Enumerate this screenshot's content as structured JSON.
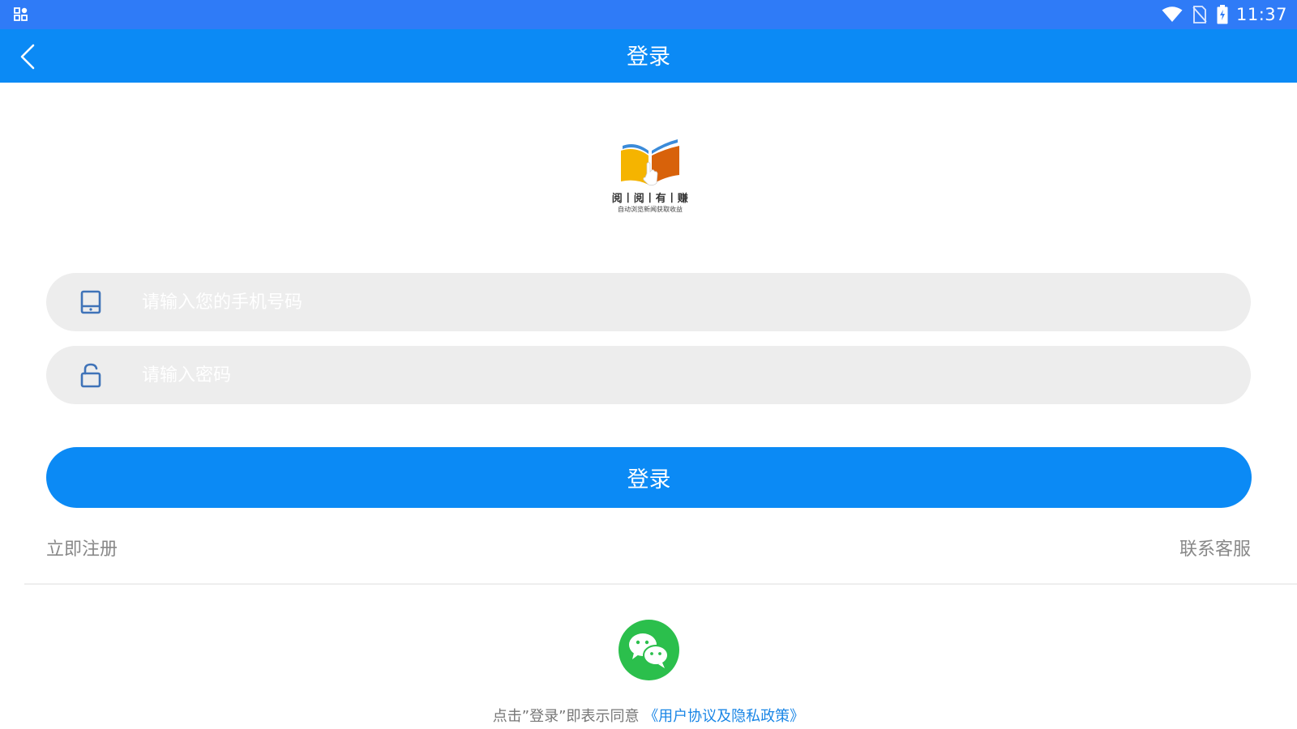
{
  "status_bar": {
    "time": "11:37",
    "icons": [
      "app-grid-icon",
      "wifi-icon",
      "no-sim-icon",
      "battery-charging-icon"
    ]
  },
  "header": {
    "title": "登录",
    "back_icon": "chevron-left-icon"
  },
  "logo": {
    "name": "阅丨阅丨有丨赚",
    "slogan": "自动浏览新闻获取收益"
  },
  "form": {
    "phone": {
      "value": "",
      "placeholder": "请输入您的手机号码",
      "icon": "phone-icon"
    },
    "password": {
      "value": "",
      "placeholder": "请输入密码",
      "icon": "lock-open-icon"
    },
    "login_label": "登录"
  },
  "links": {
    "register": "立即注册",
    "support": "联系客服"
  },
  "social": {
    "wechat_icon": "wechat-icon"
  },
  "agreement": {
    "prefix": "点击”登录”即表示同意",
    "link": "《用户协议及隐私政策》"
  },
  "colors": {
    "status_bar": "#2f7bf7",
    "primary": "#0b8af5",
    "input_bg": "#ededed",
    "wechat": "#2bbf4c",
    "link": "#1a86e6"
  }
}
